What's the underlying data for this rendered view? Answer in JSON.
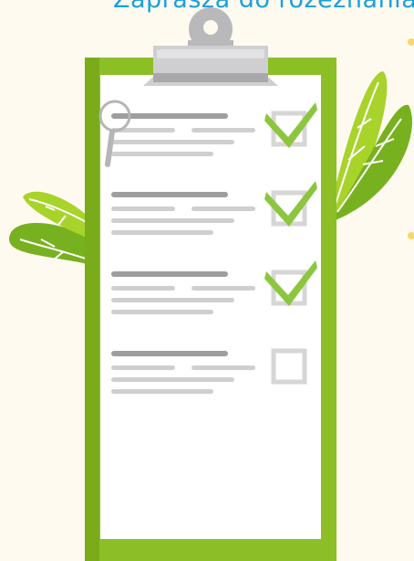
{
  "header": {
    "text": "Zaprasza do rozeznania"
  },
  "checklist": {
    "items": [
      {
        "checked": true
      },
      {
        "checked": true
      },
      {
        "checked": true
      },
      {
        "checked": false
      }
    ]
  },
  "colors": {
    "background": "#fffaf0",
    "board": "#8cbf26",
    "board_dark": "#7aab1b",
    "check": "#8cc63f",
    "clip": "#b9b9bb",
    "text_lines": "#cfcfcf",
    "heading_lines": "#9e9e9e",
    "leaf_light": "#a8d32a",
    "leaf_dark": "#78b120",
    "header": "#1ba0dc"
  },
  "icons": [
    "magnifier-icon",
    "check-icon",
    "leaf-icon",
    "clipboard-clip-icon"
  ]
}
